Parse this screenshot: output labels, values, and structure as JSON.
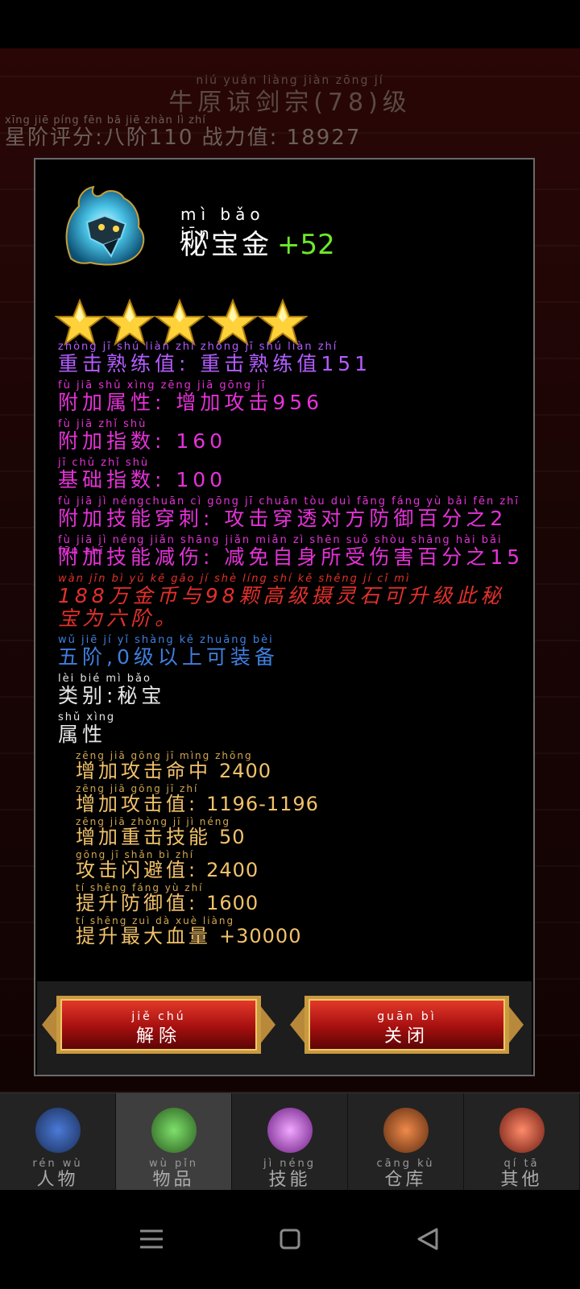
{
  "background": {
    "title_pinyin": "niú yuán liàng jiàn zōng          jí",
    "title": "牛原谅剑宗(78)级",
    "rating_pinyin": "xīng jiē píng fēn  bā  jiē        zhàn lì  zhí",
    "rating_line": "星阶评分:八阶110 战力值: 18927"
  },
  "item": {
    "icon": "blue-flame-wolf-icon",
    "name_pinyin": "mì  bǎo jīn",
    "name": "秘宝金",
    "plus": "+52",
    "star_count": 5
  },
  "lines": [
    {
      "py": "zhòng  jī   shú liàn zhí        zhòng  jī   shú liàn zhí",
      "text": "重击熟练值: 重击熟练值151",
      "color": "purple"
    },
    {
      "py": "fù   jiā  shǔ xìng        zēng jiā gōng  jī",
      "text": "附加属性: 增加攻击956",
      "color": "magenta"
    },
    {
      "py": "fù   jiā  zhǐ shù",
      "text": "附加指数: 160",
      "color": "magenta"
    },
    {
      "py": "jī  chǔ  zhǐ shù",
      "text": "基础指数: 100",
      "color": "magenta"
    },
    {
      "py": "fù   jiā   jì  néngchuān cì       gōng  jī  chuān tòu duì fāng fáng yù  bǎi  fēn  zhī",
      "text": "附加技能穿刺: 攻击穿透对方防御百分之2",
      "color": "magenta"
    },
    {
      "py": "fù   jiā   jì  néng jiǎn shāng      jiǎn miǎn  zì  shēn suǒ shòu shāng hài  bǎi  fēn  zhī",
      "text": "附加技能减伤: 减免自身所受伤害百分之15",
      "color": "magenta"
    },
    {
      "py": "          wàn jīn  bì   yǔ        kē  gāo  jí  shè líng shí  kě shēng  jí   cǐ   mì",
      "text": "188万金币与98颗高级摄灵石可升级此秘宝为六阶。",
      "color": "red"
    },
    {
      "py": "wǔ  jiē        jí    yǐ  shàng  kě  zhuāng bèi",
      "text": "五阶,0级以上可装备",
      "color": "blue"
    },
    {
      "py": "lèi  bié   mì  bǎo",
      "text": "类别:秘宝",
      "color": "white"
    },
    {
      "py": "shǔ xìng",
      "text": "属性",
      "color": "white"
    }
  ],
  "attributes": [
    {
      "py": "zēng  jiā  gōng  jī   mìng zhōng",
      "label": "增加攻击命中",
      "value": "2400"
    },
    {
      "py": "zēng  jiā  gōng  jī   zhí",
      "label": "增加攻击值:",
      "value": "1196-1196"
    },
    {
      "py": "zēng  jiā zhòng  jī    jì  néng",
      "label": "增加重击技能",
      "value": "50"
    },
    {
      "py": "gōng  jī  shǎn  bì  zhí",
      "label": "攻击闪避值:",
      "value": "2400"
    },
    {
      "py": " tí  shēng fáng  yù  zhí",
      "label": "提升防御值:",
      "value": "1600"
    },
    {
      "py": " tí  shēng zuì  dà  xuè liàng",
      "label": "提升最大血量",
      "value": "+30000"
    }
  ],
  "buttons": {
    "unequip_py": "jiě  chú",
    "unequip": "解除",
    "close_py": "guān  bì",
    "close": "关闭"
  },
  "tabs": [
    {
      "py": "rén  wù",
      "label": "人物",
      "icon": "character-icon",
      "active": false
    },
    {
      "py": "wù  pǐn",
      "label": "物品",
      "icon": "item-bag-icon",
      "active": true
    },
    {
      "py": "jì  néng",
      "label": "技能",
      "icon": "skill-orb-icon",
      "active": false
    },
    {
      "py": "cāng kù",
      "label": "仓库",
      "icon": "warehouse-icon",
      "active": false
    },
    {
      "py": "qí  tā",
      "label": "其他",
      "icon": "other-icon",
      "active": false
    }
  ],
  "colors": {
    "purple": "#b45cff",
    "magenta": "#e632d8",
    "red": "#e3302a",
    "blue": "#3f7fe0",
    "gold": "#f2c26a",
    "plus_green": "#6ee82a"
  }
}
